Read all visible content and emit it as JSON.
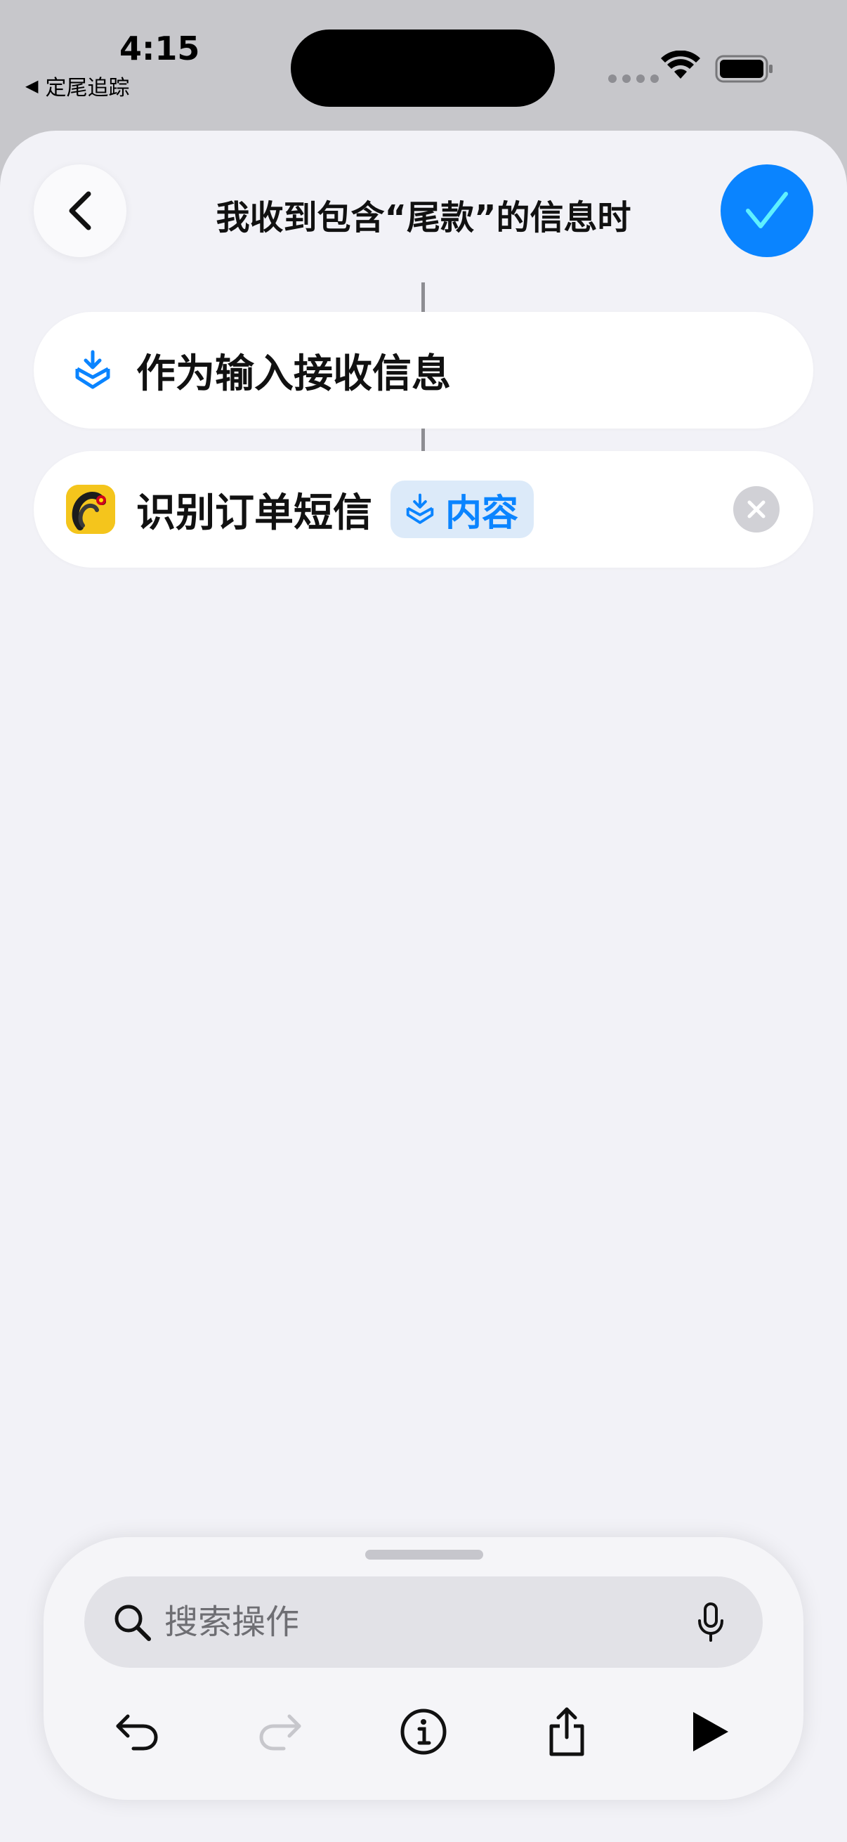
{
  "status_bar": {
    "time": "4:15",
    "back_app": "定尾追踪"
  },
  "header": {
    "title": "我收到包含“尾款”的信息时"
  },
  "actions": [
    {
      "label": "作为输入接收信息"
    },
    {
      "label": "识别订单短信",
      "variable": "内容"
    }
  ],
  "search": {
    "placeholder": "搜索操作"
  },
  "colors": {
    "accent": "#0a84ff",
    "background": "#f2f2f7",
    "app_icon": "#f4c51c"
  }
}
